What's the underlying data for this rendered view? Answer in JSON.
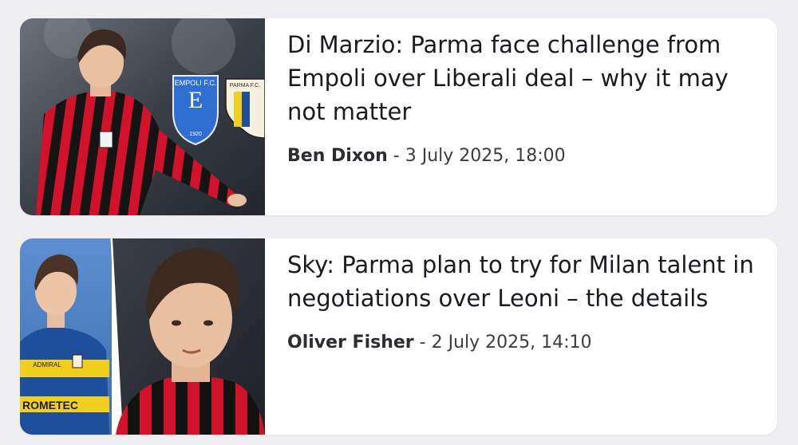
{
  "articles": [
    {
      "headline": "Di Marzio: Parma face challenge from Empoli over Liberali deal – why it may not matter",
      "author": "Ben Dixon",
      "separator": " - ",
      "date": "3 July 2025, 18:00",
      "image": {
        "badge_left_text": "EMPOLI F.C.",
        "badge_left_year": "1920",
        "badge_right_text": "PARMA F.C."
      }
    },
    {
      "headline": "Sky: Parma plan to try for Milan talent in negotiations over Leoni – the details",
      "author": "Oliver Fisher",
      "separator": " - ",
      "date": "2 July 2025, 14:10",
      "image": {
        "shirt_sponsor_top": "ADMIRAL",
        "shirt_sponsor_bottom": "ROMETEC"
      }
    }
  ],
  "colors": {
    "page_bg": "#efeff1",
    "card_bg": "#ffffff",
    "headline": "#1b1b1f",
    "meta": "#3c3c41",
    "milan_red": "#c8102e",
    "parma_blue": "#1d4f9b",
    "parma_yellow": "#f2cf1f",
    "empoli_blue": "#2f6fd1"
  }
}
